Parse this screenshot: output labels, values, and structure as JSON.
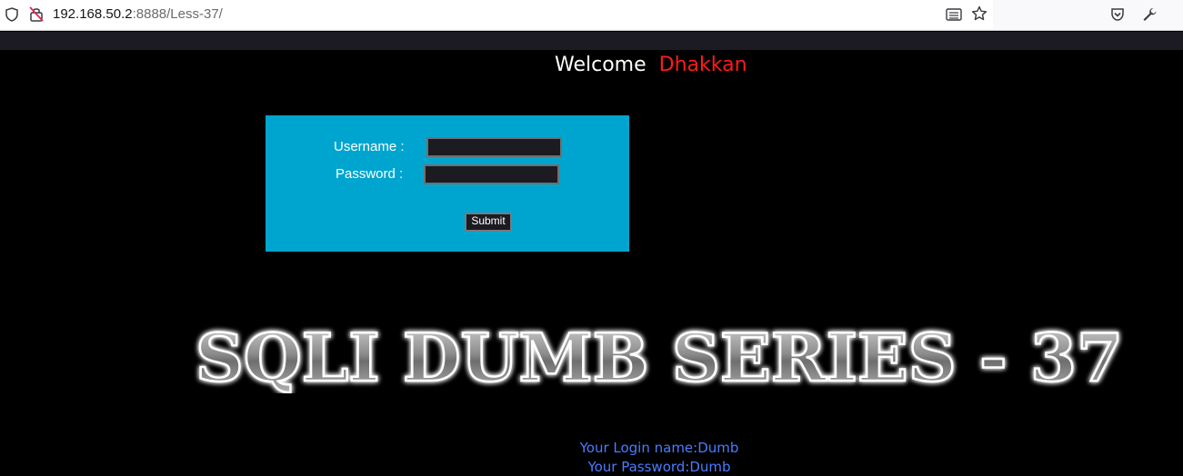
{
  "browser": {
    "url_host": "192.168.50.2",
    "url_path": ":8888/Less-37/",
    "icons": [
      "shield-icon",
      "insecure-lock-icon",
      "reader-view-icon",
      "bookmark-star-icon",
      "pocket-icon",
      "wrench-icon"
    ]
  },
  "welcome": {
    "text": "Welcome",
    "name": "Dhakkan"
  },
  "login": {
    "username_label": "Username :",
    "password_label": "Password :",
    "username_value": "",
    "password_value": "",
    "submit_label": "Submit"
  },
  "title": {
    "text": "SQLI DUMB SERIES - 37"
  },
  "result": {
    "login_name": "Your Login name:Dumb",
    "password": "Your Password:Dumb"
  },
  "colors": {
    "page_background": "#000000",
    "login_box": "#00a5cf",
    "welcome_name": "#ff1a1a",
    "result_text": "#4a7cff"
  }
}
